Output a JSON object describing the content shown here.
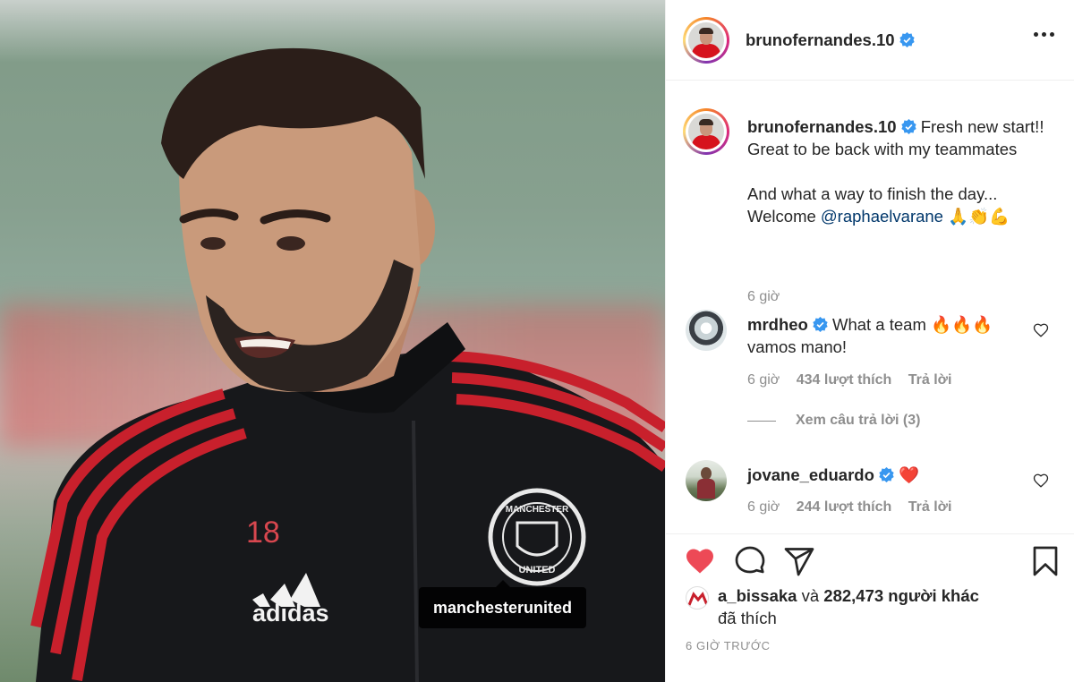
{
  "post": {
    "photo_tag": "manchesterunited",
    "photo_shirt_number": "18",
    "photo_brand_text": "adidas",
    "photo_crest_top": "MANCHESTER",
    "photo_crest_bottom": "UNITED"
  },
  "header": {
    "username": "brunofernandes.10",
    "verified": true
  },
  "caption": {
    "username": "brunofernandes.10",
    "line1": "Fresh new start!! Great to be back with my teammates",
    "line2_prefix": "And what a way to finish the day... Welcome ",
    "mention": "@raphaelvarane",
    "emoji": "🙏👏💪",
    "time": "6 giờ"
  },
  "comments": [
    {
      "username": "mrdheo",
      "verified": true,
      "text": "What a team 🔥🔥🔥 vamos mano!",
      "time": "6 giờ",
      "likes": "434 lượt thích",
      "reply": "Trả lời",
      "view_replies": "Xem câu trả lời (3)"
    },
    {
      "username": "jovane_eduardo",
      "verified": true,
      "text": "❤️",
      "time": "6 giờ",
      "likes": "244 lượt thích",
      "reply": "Trả lời"
    }
  ],
  "actions": {
    "liked": true,
    "icons": [
      "heart-icon",
      "comment-icon",
      "share-icon",
      "bookmark-icon"
    ]
  },
  "likes_summary": {
    "liker": "a_bissaka",
    "and": "và",
    "count_text": "282,473 người khác",
    "suffix": "đã thích"
  },
  "timestamp": "6 GIỜ TRƯỚC",
  "colors": {
    "like_red": "#ed4956",
    "verified_blue": "#3897f0",
    "mention_blue": "#00376b",
    "muted_gray": "#8e8e8e"
  }
}
